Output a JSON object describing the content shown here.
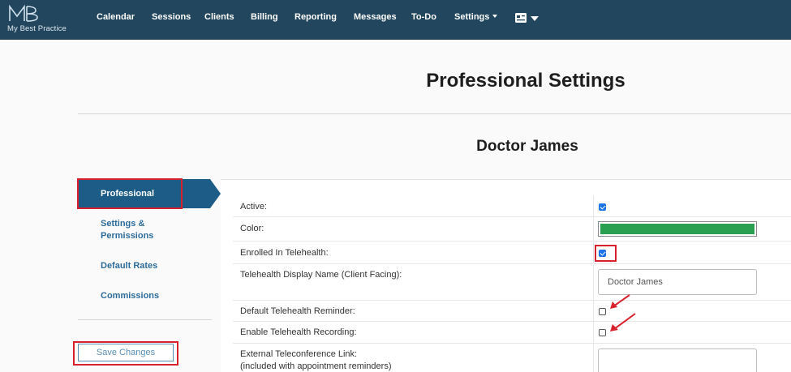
{
  "brand": {
    "logo_text": "My Best Practice"
  },
  "nav": {
    "items": [
      "Calendar",
      "Sessions",
      "Clients",
      "Billing",
      "Reporting",
      "Messages",
      "To-Do",
      "Settings"
    ]
  },
  "page": {
    "title": "Professional Settings",
    "person_name": "Doctor James"
  },
  "menu": {
    "active": "Professional",
    "items": [
      "Settings & Permissions",
      "Default Rates",
      "Commissions"
    ],
    "save_label": "Save Changes"
  },
  "form": {
    "active_label": "Active:",
    "active_checked": true,
    "color_label": "Color:",
    "color_value": "#28a050",
    "telehealth_label": "Enrolled In Telehealth:",
    "telehealth_checked": true,
    "display_name_label": "Telehealth Display Name (Client Facing):",
    "display_name_value": "Doctor James",
    "reminder_label": "Default Telehealth Reminder:",
    "reminder_checked": false,
    "recording_label": "Enable Telehealth Recording:",
    "recording_checked": false,
    "external_link_label_line1": "External Teleconference Link:",
    "external_link_label_line2": "(included with appointment reminders)",
    "external_link_value": ""
  },
  "colors": {
    "nav_bg": "#21465e",
    "menu_active": "#1d5c86",
    "annotation_red": "#d8212c"
  }
}
